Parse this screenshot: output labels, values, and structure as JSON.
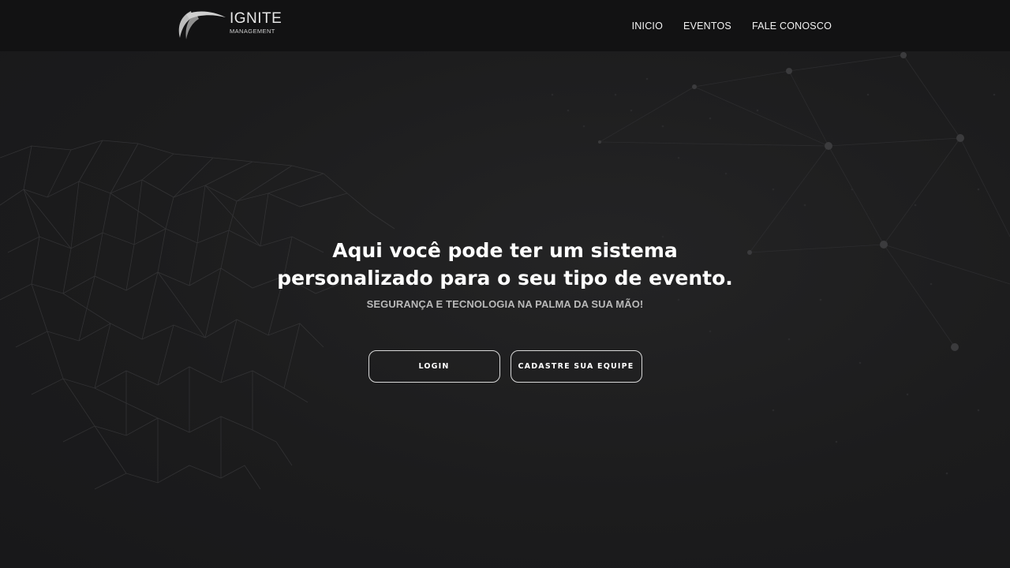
{
  "header": {
    "logo": {
      "brand": "IGNITE",
      "subtitle": "MANAGEMENT",
      "icon": "swoosh-logo-icon"
    },
    "nav": [
      {
        "label": "INICIO"
      },
      {
        "label": "EVENTOS"
      },
      {
        "label": "FALE CONOSCO"
      }
    ]
  },
  "hero": {
    "headline_line1": "Aqui você pode ter um sistema",
    "headline_line2": "personalizado para o seu tipo de evento.",
    "tagline": "SEGURANÇA E TECNOLOGIA NA PALMA DA SUA MÃO!",
    "buttons": {
      "login": "LOGIN",
      "register": "CADASTRE SUA EQUIPE"
    }
  },
  "colors": {
    "background": "#1b1b1c",
    "header": "#121213",
    "text": "#ffffff",
    "tagline": "#b9b9b9",
    "button_border": "#d8d8d8"
  }
}
